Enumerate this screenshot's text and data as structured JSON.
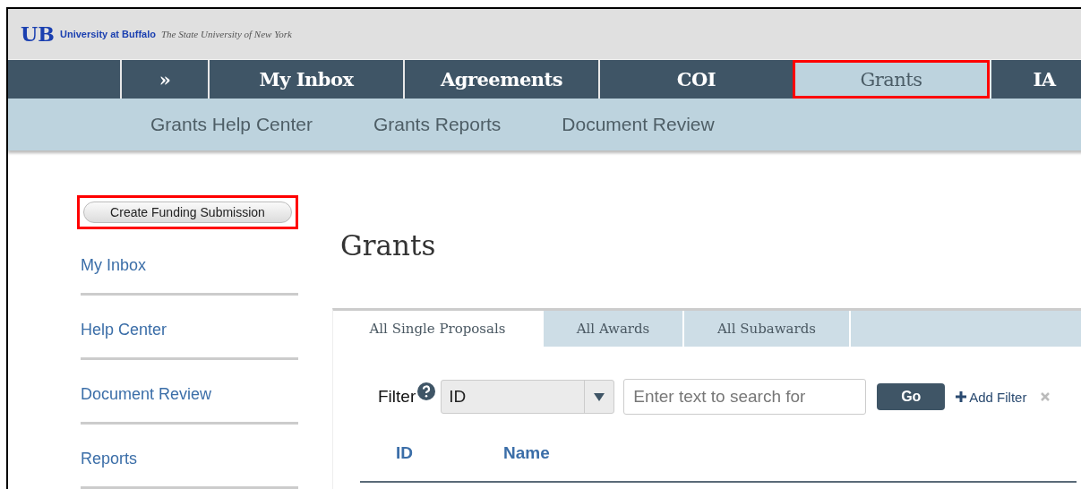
{
  "header": {
    "logo_mark": "UB",
    "university": "University at Buffalo",
    "tagline": "The State University of New York"
  },
  "nav": [
    {
      "label": "»",
      "selected": false,
      "highlighted": false
    },
    {
      "label": "My Inbox",
      "selected": false,
      "highlighted": false
    },
    {
      "label": "Agreements",
      "selected": false,
      "highlighted": false
    },
    {
      "label": "COI",
      "selected": false,
      "highlighted": false
    },
    {
      "label": "Grants",
      "selected": true,
      "highlighted": true
    },
    {
      "label": "IA",
      "selected": false,
      "highlighted": false
    }
  ],
  "subnav": [
    "Grants Help Center",
    "Grants Reports",
    "Document Review"
  ],
  "sidebar": {
    "create_button": {
      "label": "Create Funding Submission",
      "highlighted": true
    },
    "links": [
      "My Inbox",
      "Help Center",
      "Document Review",
      "Reports"
    ]
  },
  "page_title": "Grants",
  "tabs": [
    {
      "label": "All Single Proposals",
      "selected": true
    },
    {
      "label": "All Awards",
      "selected": false
    },
    {
      "label": "All Subawards",
      "selected": false
    }
  ],
  "filter": {
    "label": "Filter",
    "field": "ID",
    "search": {
      "placeholder": "Enter text to search for"
    },
    "go": "Go",
    "add_filter": "Add Filter"
  },
  "table": {
    "columns": [
      "ID",
      "Name"
    ]
  }
}
